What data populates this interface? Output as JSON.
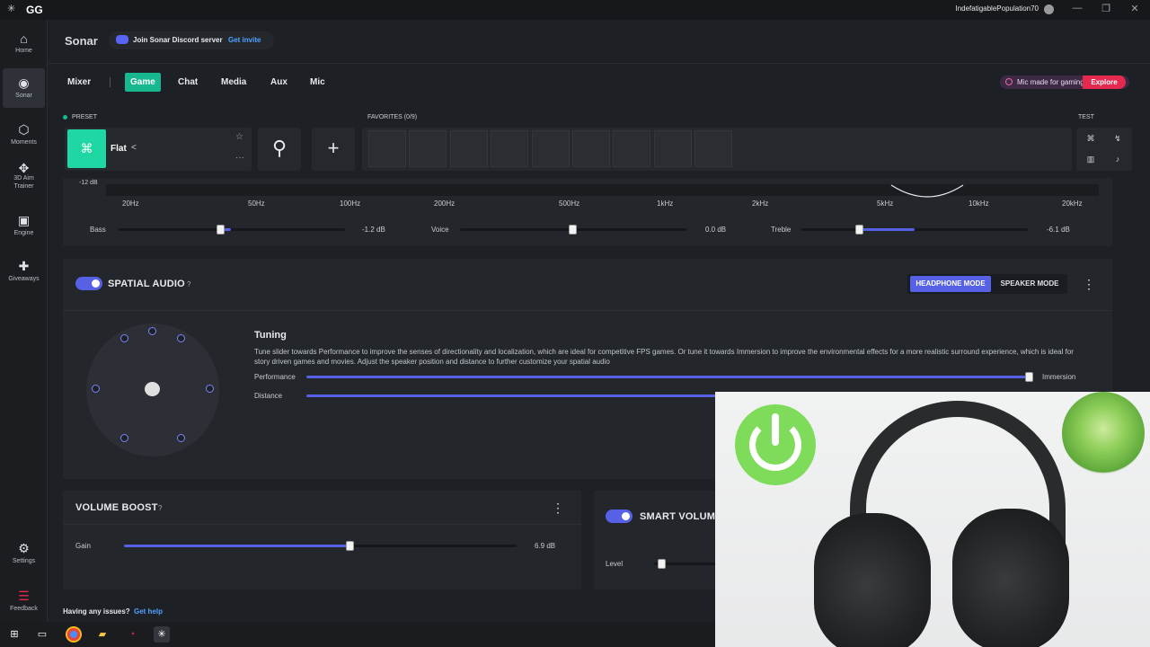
{
  "titlebar": {
    "app": "GG",
    "username": "IndefatigablePopulation70",
    "minimize": "—",
    "restore": "❐",
    "close": "✕"
  },
  "sidebar": [
    {
      "label": "Home",
      "icon": "⌂"
    },
    {
      "label": "Sonar",
      "icon": "◉"
    },
    {
      "label": "Moments",
      "icon": "⬡"
    },
    {
      "label": "3D Aim Trainer",
      "icon": "✥"
    },
    {
      "label": "Engine",
      "icon": "▣"
    },
    {
      "label": "Giveaways",
      "icon": "✚"
    },
    {
      "label": "Settings",
      "icon": "⚙"
    },
    {
      "label": "Feedback",
      "icon": "☰"
    }
  ],
  "header": {
    "title": "Sonar",
    "discord_text": "Join Sonar Discord server",
    "discord_link": "Get invite"
  },
  "tabs": [
    "Mixer",
    "Game",
    "Chat",
    "Media",
    "Aux",
    "Mic"
  ],
  "selected_tab": "Game",
  "promo": {
    "text": "Mic made for gaming",
    "button": "Explore"
  },
  "preset": {
    "label": "PRESET",
    "name": "Flat",
    "favorites_label": "FAVORITES (0/9)",
    "test_label": "TEST"
  },
  "eq": {
    "db_label": "-12 dB",
    "freqs": [
      "20Hz",
      "50Hz",
      "100Hz",
      "200Hz",
      "500Hz",
      "1kHz",
      "2kHz",
      "5kHz",
      "10kHz",
      "20kHz"
    ],
    "sliders": [
      {
        "label": "Bass",
        "value_text": "-1.2 dB",
        "value": -1.2
      },
      {
        "label": "Voice",
        "value_text": "0.0 dB",
        "value": 0.0
      },
      {
        "label": "Treble",
        "value_text": "-6.1 dB",
        "value": -6.1
      }
    ]
  },
  "spatial": {
    "title": "SPATIAL AUDIO",
    "help": "?",
    "mode_on": "HEADPHONE MODE",
    "mode_off": "SPEAKER MODE",
    "tuning_title": "Tuning",
    "tuning_desc": "Tune slider towards Performance to improve the senses of directionality and localization, which are ideal for competitive FPS games. Or tune it towards Immersion to improve the environmental effects for a more realistic surround experience, which is ideal for story driven games and movies. Adjust the speaker position and distance to further customize your spatial audio",
    "performance_label": "Performance",
    "immersion_label": "Immersion",
    "distance_label": "Distance",
    "tuning_value": 0.98,
    "distance_value": 0.9
  },
  "volume_boost": {
    "title": "VOLUME BOOST",
    "help": "?",
    "gain_label": "Gain",
    "gain_value_text": "6.9 dB",
    "gain_value": 0.57
  },
  "smart_volume": {
    "title": "SMART VOLUME",
    "level_label": "Level"
  },
  "footer": {
    "text": "Having any issues?",
    "link": "Get help"
  },
  "colors": {
    "accent": "#5661e6",
    "green": "#17b890",
    "brand_red": "#e5294f"
  }
}
